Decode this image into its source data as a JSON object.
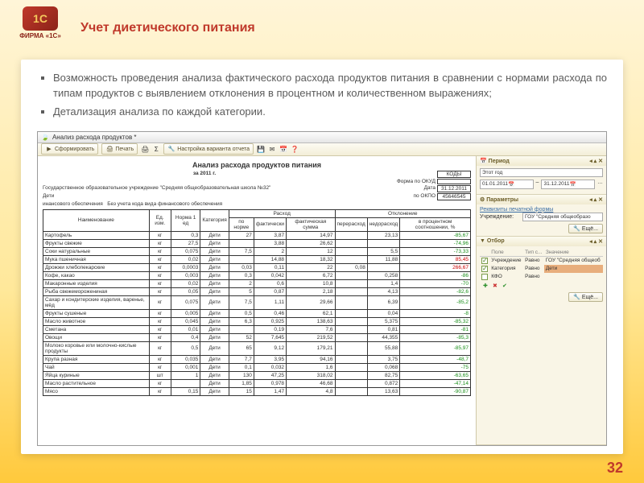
{
  "header": {
    "logo_text": "ФИРМА «1С»",
    "title": "Учет диетического питания"
  },
  "bullets": [
    "Возможность проведения анализа фактического расхода продуктов питания в сравнении с нормами расхода по типам продуктов с выявлением отклонения в процентном и количественном выражениях;",
    "Детализация анализа по каждой категории."
  ],
  "app": {
    "window_title": "Анализ расхода продуктов *",
    "toolbar": {
      "generate": "Сформировать",
      "print": "Печать",
      "variant": "Настройка варианта отчета"
    },
    "report": {
      "title": "Анализ расхода продуктов питания",
      "period": "за 2011 г.",
      "institution": "Государственное образовательное учреждение \"Средняя общеобразовательная школа №32\"",
      "category_label": "",
      "category": "Дети",
      "finance_label": "инансового обеспечения",
      "finance": "Без учета кода вида финансового обеспечения",
      "codes": {
        "kody": "КОДЫ",
        "okud_label": "Форма по ОКУД",
        "date_label": "Дата",
        "date": "31.12.2011",
        "okpo_label": "по ОКПО",
        "okpo": "45646545"
      },
      "columns": {
        "name": "Наименование",
        "unit": "Ед. изм.",
        "norm": "Норма 1 ед",
        "category": "Категория",
        "expense": "Расход",
        "by_norm": "по норме",
        "actual": "фактически",
        "actual_sum": "фактическая сумма",
        "deviation": "Отклонение",
        "over": "перерасход",
        "under": "недорасход",
        "percent": "в процентном соотношении, %"
      }
    },
    "table": [
      {
        "name": "Картофель",
        "unit": "кг",
        "norm": "0,3",
        "cat": "Дети",
        "n": "27",
        "f": "3,87",
        "fs": "14,97",
        "over": "",
        "under": "23,13",
        "pct": "-85,67",
        "cls": "green"
      },
      {
        "name": "Фрукты свежие",
        "unit": "кг",
        "norm": "27,5",
        "cat": "Дети",
        "n": "",
        "f": "3,88",
        "fs": "26,62",
        "over": "",
        "under": "",
        "pct": "-74,96",
        "cls": "green"
      },
      {
        "name": "Соки натуральные",
        "unit": "кг",
        "norm": "0,075",
        "cat": "Дети",
        "n": "7,5",
        "f": "2",
        "fs": "12",
        "over": "",
        "under": "5,5",
        "pct": "-73,33",
        "cls": "green"
      },
      {
        "name": "Мука пшеничная",
        "unit": "кг",
        "norm": "0,02",
        "cat": "Дети",
        "n": "",
        "f": "14,88",
        "fs": "18,32",
        "over": "",
        "under": "11,88",
        "pct": "85,45",
        "cls": "red"
      },
      {
        "name": "Дрожжи хлебопекарские",
        "unit": "кг",
        "norm": "0,0003",
        "cat": "Дети",
        "n": "0,03",
        "f": "0,11",
        "fs": "22",
        "over": "0,08",
        "under": "",
        "pct": "266,67",
        "cls": "red"
      },
      {
        "name": "Кофе, какао",
        "unit": "кг",
        "norm": "0,003",
        "cat": "Дети",
        "n": "0,3",
        "f": "0,042",
        "fs": "6,72",
        "over": "",
        "under": "0,258",
        "pct": "-86",
        "cls": "green"
      },
      {
        "name": "Макаронные изделия",
        "unit": "кг",
        "norm": "0,02",
        "cat": "Дети",
        "n": "2",
        "f": "0,6",
        "fs": "10,8",
        "over": "",
        "under": "1,4",
        "pct": "-70",
        "cls": "green"
      },
      {
        "name": "Рыба свежеморожениная",
        "unit": "кг",
        "norm": "0,05",
        "cat": "Дети",
        "n": "5",
        "f": "0,87",
        "fs": "2,18",
        "over": "",
        "under": "4,13",
        "pct": "-82,6",
        "cls": "green"
      },
      {
        "name": "Сахар и кондитерские изделия, варенье, мёд",
        "unit": "кг",
        "norm": "0,075",
        "cat": "Дети",
        "n": "7,5",
        "f": "1,11",
        "fs": "29,66",
        "over": "",
        "under": "6,39",
        "pct": "-85,2",
        "cls": "green"
      },
      {
        "name": "Фрукты сушеные",
        "unit": "кг",
        "norm": "0,005",
        "cat": "Дети",
        "n": "0,5",
        "f": "0,46",
        "fs": "62,1",
        "over": "",
        "under": "0,04",
        "pct": "-8",
        "cls": "green"
      },
      {
        "name": "Масло животное",
        "unit": "кг",
        "norm": "0,045",
        "cat": "Дети",
        "n": "6,3",
        "f": "0,925",
        "fs": "138,63",
        "over": "",
        "under": "5,375",
        "pct": "-85,32",
        "cls": "green"
      },
      {
        "name": "Сметана",
        "unit": "кг",
        "norm": "0,01",
        "cat": "Дети",
        "n": "",
        "f": "0,19",
        "fs": "7,6",
        "over": "",
        "under": "0,81",
        "pct": "-81",
        "cls": "green"
      },
      {
        "name": "Овощи",
        "unit": "кг",
        "norm": "0,4",
        "cat": "Дети",
        "n": "52",
        "f": "7,645",
        "fs": "219,52",
        "over": "",
        "under": "44,355",
        "pct": "-85,3",
        "cls": "green"
      },
      {
        "name": "Молоко коровье или молочно-кислые продукты",
        "unit": "кг",
        "norm": "0,5",
        "cat": "Дети",
        "n": "65",
        "f": "9,12",
        "fs": "179,21",
        "over": "",
        "under": "55,88",
        "pct": "-85,97",
        "cls": "green"
      },
      {
        "name": "Крупа разная",
        "unit": "кг",
        "norm": "0,035",
        "cat": "Дети",
        "n": "7,7",
        "f": "3,95",
        "fs": "94,16",
        "over": "",
        "under": "3,75",
        "pct": "-48,7",
        "cls": "green"
      },
      {
        "name": "Чай",
        "unit": "кг",
        "norm": "0,001",
        "cat": "Дети",
        "n": "0,1",
        "f": "0,032",
        "fs": "1,6",
        "over": "",
        "under": "0,068",
        "pct": "-75",
        "cls": "green"
      },
      {
        "name": "Яйца куриные",
        "unit": "шт",
        "norm": "1",
        "cat": "Дети",
        "n": "130",
        "f": "47,25",
        "fs": "318,02",
        "over": "",
        "under": "82,75",
        "pct": "-63,65",
        "cls": "green"
      },
      {
        "name": "Масло растительное",
        "unit": "кг",
        "norm": "",
        "cat": "Дети",
        "n": "1,85",
        "f": "0,978",
        "fs": "46,68",
        "over": "",
        "under": "0,872",
        "pct": "-47,14",
        "cls": "green"
      },
      {
        "name": "Мясо",
        "unit": "кг",
        "norm": "0,15",
        "cat": "Дети",
        "n": "15",
        "f": "1,47",
        "fs": "4,8",
        "over": "",
        "under": "13,63",
        "pct": "-90,87",
        "cls": "green"
      }
    ],
    "side": {
      "period_title": "Период",
      "period_value": "Этот год",
      "date_from": "01.01.2011",
      "date_to": "31.12.2011",
      "params_title": "Параметры",
      "requisites": "Реквизиты печатной формы",
      "inst_label": "Учреждение:",
      "inst_value": "ГОУ \"Средняя общеобразо",
      "more": "Ещё...",
      "filter_title": "Отбор",
      "filter_cols": {
        "field": "Поле",
        "type": "Тип с...",
        "value": "Значение"
      },
      "filter_rows": [
        {
          "on": true,
          "field": "Учреждение",
          "type": "Равно",
          "value": "ГОУ \"Средняя общеоб"
        },
        {
          "on": true,
          "field": "Категория",
          "type": "Равно",
          "value": "Дети",
          "hl": true
        },
        {
          "on": false,
          "field": "КФО",
          "type": "Равно",
          "value": ""
        }
      ]
    }
  },
  "page_num": "32"
}
